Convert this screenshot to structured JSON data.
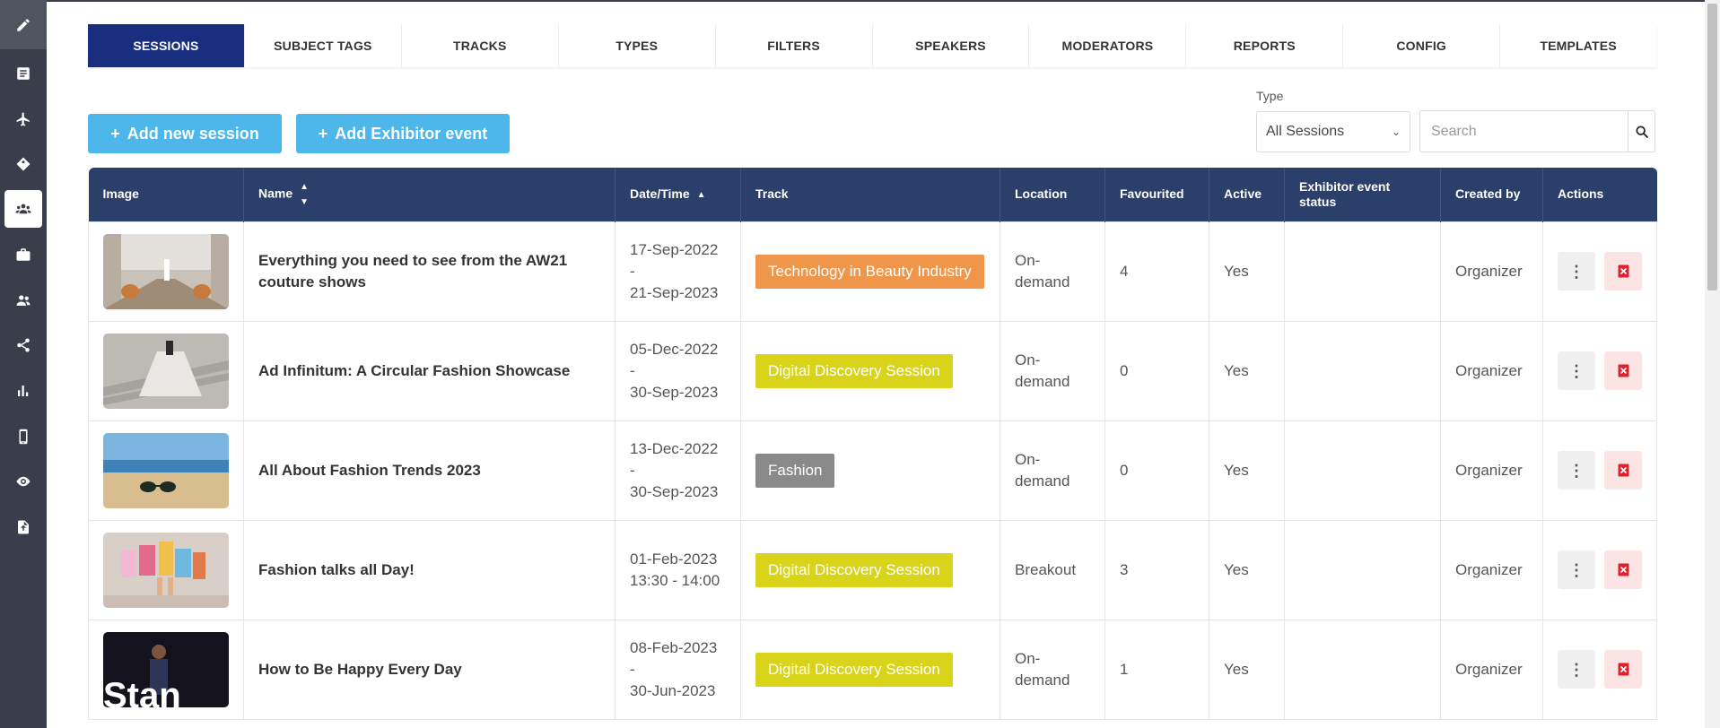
{
  "sidebar": {
    "icons": [
      "pencil-icon",
      "document-icon",
      "plane-icon",
      "tag-icon",
      "users-group-icon",
      "briefcase-icon",
      "people-icon",
      "share-icon",
      "bar-chart-icon",
      "mobile-icon",
      "eye-icon",
      "file-upload-icon"
    ],
    "active_index": 4
  },
  "tabs": [
    {
      "label": "SESSIONS",
      "active": true
    },
    {
      "label": "SUBJECT TAGS"
    },
    {
      "label": "TRACKS"
    },
    {
      "label": "TYPES"
    },
    {
      "label": "FILTERS"
    },
    {
      "label": "SPEAKERS"
    },
    {
      "label": "MODERATORS"
    },
    {
      "label": "REPORTS"
    },
    {
      "label": "CONFIG"
    },
    {
      "label": "TEMPLATES"
    }
  ],
  "toolbar": {
    "add_session_label": "Add new session",
    "add_exhibitor_label": "Add Exhibitor event",
    "plus": "+",
    "type_label": "Type",
    "type_value": "All Sessions",
    "search_placeholder": "Search"
  },
  "table": {
    "headers": {
      "image": "Image",
      "name": "Name",
      "datetime": "Date/Time",
      "track": "Track",
      "location": "Location",
      "favourited": "Favourited",
      "active": "Active",
      "exhibitor_status": "Exhibitor event status",
      "created_by": "Created by",
      "actions": "Actions"
    },
    "rows": [
      {
        "name": "Everything you need to see from the AW21 couture shows",
        "date1": "17-Sep-2022 -",
        "date2": "21-Sep-2023",
        "track": "Technology in Beauty Industry",
        "track_color": "#f0964a",
        "location1": "On-",
        "location2": "demand",
        "favourited": "4",
        "active": "Yes",
        "exhibitor_status": "",
        "created_by": "Organizer"
      },
      {
        "name": "Ad Infinitum: A Circular Fashion Showcase",
        "date1": "05-Dec-2022 -",
        "date2": "30-Sep-2023",
        "track": "Digital Discovery Session",
        "track_color": "#d9d41a",
        "location1": "On-",
        "location2": "demand",
        "favourited": "0",
        "active": "Yes",
        "exhibitor_status": "",
        "created_by": "Organizer"
      },
      {
        "name": "All About Fashion Trends 2023",
        "date1": "13-Dec-2022 -",
        "date2": "30-Sep-2023",
        "track": "Fashion",
        "track_color": "#8a8a8a",
        "location1": "On-",
        "location2": "demand",
        "favourited": "0",
        "active": "Yes",
        "exhibitor_status": "",
        "created_by": "Organizer"
      },
      {
        "name": "Fashion talks all Day!",
        "date1": "01-Feb-2023",
        "date2": "13:30 - 14:00",
        "track": "Digital Discovery Session",
        "track_color": "#d9d41a",
        "location1": "Breakout",
        "location2": "",
        "favourited": "3",
        "active": "Yes",
        "exhibitor_status": "",
        "created_by": "Organizer"
      },
      {
        "name": "How to Be Happy Every Day",
        "date1": "08-Feb-2023 -",
        "date2": "30-Jun-2023",
        "track": "Digital Discovery Session",
        "track_color": "#d9d41a",
        "location1": "On-",
        "location2": "demand",
        "favourited": "1",
        "active": "Yes",
        "exhibitor_status": "",
        "created_by": "Organizer"
      }
    ]
  },
  "colors": {
    "sidebar_bg": "#3a3e4a",
    "tab_active": "#1a2e80",
    "header_bg": "#2b3f6b",
    "button_blue": "#4db6ea",
    "delete_red": "#e0202d"
  }
}
